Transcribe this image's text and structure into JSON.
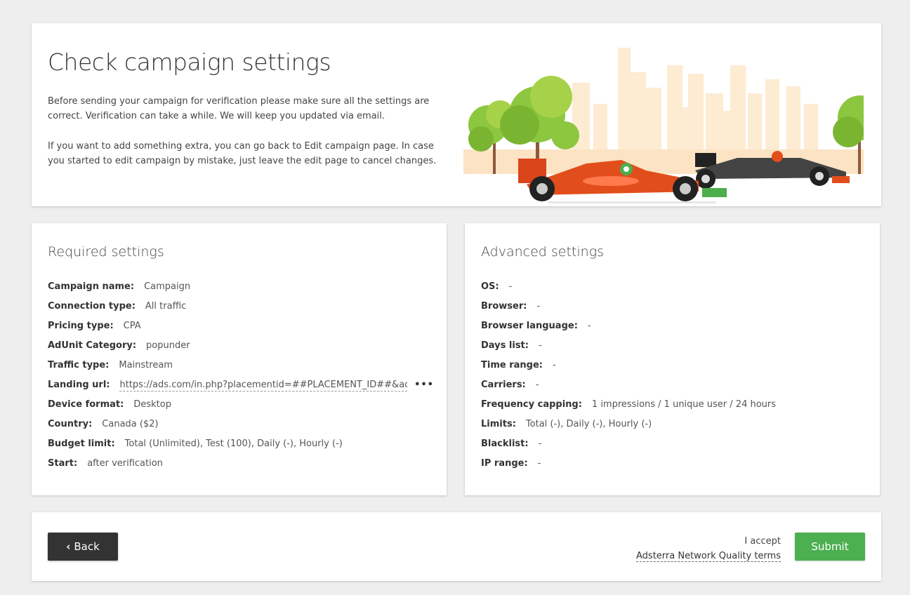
{
  "header": {
    "title": "Check campaign settings",
    "paragraph_1": "Before sending your campaign for verification please make sure all the settings are correct. Verification can take a while. We will keep you updated via email.",
    "paragraph_2": "If you want to add something extra, you can go back to Edit campaign page. In case you started to edit campaign by mistake, just leave the edit page to cancel changes."
  },
  "required": {
    "title": "Required settings",
    "rows": [
      {
        "label": "Campaign name:",
        "value": "Campaign"
      },
      {
        "label": "Connection type:",
        "value": "All traffic"
      },
      {
        "label": "Pricing type:",
        "value": "CPA"
      },
      {
        "label": "AdUnit Category:",
        "value": "popunder"
      },
      {
        "label": "Traffic type:",
        "value": "Mainstream"
      },
      {
        "label": "Landing url:",
        "value": "https://ads.com/in.php?placementid=##PLACEMENT_ID##&actic",
        "more": "•••"
      },
      {
        "label": "Device format:",
        "value": "Desktop"
      },
      {
        "label": "Country:",
        "value": "Canada ($2)"
      },
      {
        "label": "Budget limit:",
        "value": "Total (Unlimited), Test (100), Daily (-), Hourly (-)"
      },
      {
        "label": "Start:",
        "value": "after verification"
      }
    ]
  },
  "advanced": {
    "title": "Advanced settings",
    "rows": [
      {
        "label": "OS:",
        "value": "-"
      },
      {
        "label": "Browser:",
        "value": "-"
      },
      {
        "label": "Browser language:",
        "value": "-"
      },
      {
        "label": "Days list:",
        "value": "-"
      },
      {
        "label": "Time range:",
        "value": "-"
      },
      {
        "label": "Carriers:",
        "value": "-"
      },
      {
        "label": "Frequency capping:",
        "value": "1 impressions / 1 unique user / 24 hours"
      },
      {
        "label": "Limits:",
        "value": "Total (-), Daily (-), Hourly (-)"
      },
      {
        "label": "Blacklist:",
        "value": "-"
      },
      {
        "label": "IP range:",
        "value": "-"
      }
    ]
  },
  "footer": {
    "back_icon": "chevron-left-icon",
    "back_label": "Back",
    "accept_text": "I accept",
    "terms_link": "Adsterra Network Quality terms",
    "submit_label": "Submit"
  },
  "colors": {
    "submit": "#4caf50",
    "back": "#333333",
    "page_bg": "#eeeeee"
  }
}
